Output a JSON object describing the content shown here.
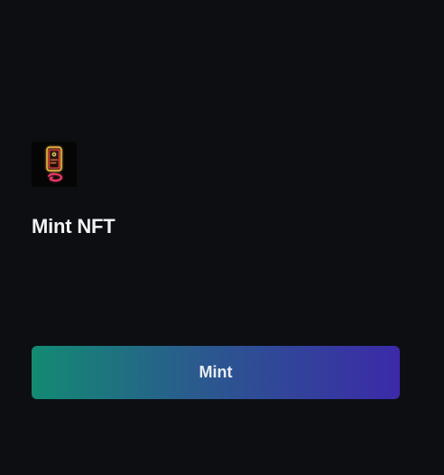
{
  "nft": {
    "image_icon": "neon-phone-nft-image",
    "title": "Mint NFT"
  },
  "actions": {
    "mint_label": "Mint"
  },
  "colors": {
    "background": "#0c0e12",
    "title_text": "#f2f3f5",
    "button_gradient_start": "#138a72",
    "button_gradient_end": "#3b2aa8",
    "button_text": "#e9ecf2"
  }
}
